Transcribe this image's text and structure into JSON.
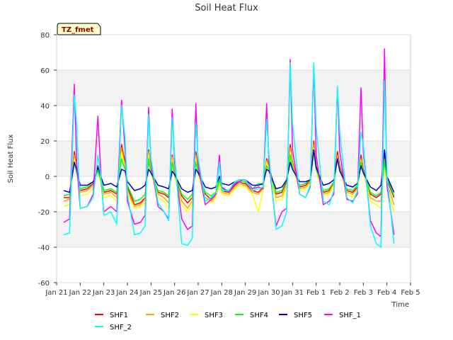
{
  "chart_data": {
    "type": "line",
    "title": "Soil Heat Flux",
    "xlabel": "Time",
    "ylabel": "Soil Heat Flux",
    "badge": "TZ_fmet",
    "ylim": [
      -60,
      80
    ],
    "yticks": [
      -60,
      -40,
      -20,
      0,
      20,
      40,
      60,
      80
    ],
    "xlim": [
      0,
      15
    ],
    "xticks": [
      {
        "x": 0,
        "label": "Jan 21"
      },
      {
        "x": 1,
        "label": "Jan 22"
      },
      {
        "x": 2,
        "label": "Jan 23"
      },
      {
        "x": 3,
        "label": "Jan 24"
      },
      {
        "x": 4,
        "label": "Jan 25"
      },
      {
        "x": 5,
        "label": "Jan 26"
      },
      {
        "x": 6,
        "label": "Jan 27"
      },
      {
        "x": 7,
        "label": "Jan 28"
      },
      {
        "x": 8,
        "label": "Jan 29"
      },
      {
        "x": 9,
        "label": "Jan 30"
      },
      {
        "x": 10,
        "label": "Jan 31"
      },
      {
        "x": 11,
        "label": "Feb 1"
      },
      {
        "x": 12,
        "label": "Feb 2"
      },
      {
        "x": 13,
        "label": "Feb 3"
      },
      {
        "x": 14,
        "label": "Feb 4"
      },
      {
        "x": 15,
        "label": "Feb 5"
      }
    ],
    "grid": true,
    "legend_position": "bottom",
    "x": [
      0.3,
      0.55,
      0.75,
      0.85,
      1.0,
      1.3,
      1.55,
      1.75,
      1.9,
      2.0,
      2.3,
      2.55,
      2.75,
      2.9,
      3.0,
      3.3,
      3.55,
      3.75,
      3.9,
      4.0,
      4.3,
      4.55,
      4.75,
      4.9,
      5.0,
      5.3,
      5.55,
      5.75,
      5.9,
      6.0,
      6.3,
      6.55,
      6.75,
      6.9,
      7.0,
      7.3,
      7.55,
      7.75,
      7.9,
      8.0,
      8.3,
      8.55,
      8.75,
      8.9,
      9.0,
      9.3,
      9.55,
      9.75,
      9.9,
      10.0,
      10.3,
      10.55,
      10.75,
      10.9,
      11.0,
      11.3,
      11.55,
      11.75,
      11.9,
      12.0,
      12.3,
      12.55,
      12.75,
      12.9,
      13.0,
      13.3,
      13.55,
      13.75,
      13.9,
      14.0,
      14.3
    ],
    "series": [
      {
        "name": "SHF1",
        "color": "#ff0000",
        "values": [
          -12,
          -12,
          14,
          5,
          -8,
          -7,
          -4,
          6,
          -3,
          -9,
          -8,
          -10,
          18,
          8,
          -6,
          -16,
          -15,
          -12,
          15,
          4,
          -9,
          -10,
          -12,
          12,
          2,
          -11,
          -15,
          -12,
          14,
          3,
          -10,
          -13,
          -10,
          -2,
          -8,
          -9,
          -5,
          -3,
          -4,
          -4,
          -8,
          -9,
          -6,
          10,
          6,
          -10,
          -9,
          -3,
          18,
          8,
          -6,
          -5,
          -2,
          20,
          6,
          -9,
          -8,
          -3,
          14,
          6,
          -8,
          -9,
          -6,
          12,
          4,
          -10,
          -12,
          -10,
          12,
          -2,
          -12
        ]
      },
      {
        "name": "SHF2",
        "color": "#ffa500",
        "values": [
          -14,
          -13,
          12,
          4,
          -9,
          -8,
          -5,
          5,
          -4,
          -10,
          -9,
          -12,
          16,
          6,
          -8,
          -17,
          -16,
          -13,
          14,
          3,
          -10,
          -12,
          -15,
          11,
          1,
          -14,
          -18,
          -14,
          12,
          2,
          -12,
          -14,
          -11,
          -3,
          -9,
          -10,
          -6,
          -4,
          -5,
          -5,
          -9,
          -10,
          -7,
          9,
          5,
          -12,
          -11,
          -5,
          16,
          7,
          -7,
          -6,
          -3,
          18,
          5,
          -10,
          -9,
          -4,
          12,
          5,
          -9,
          -10,
          -7,
          10,
          3,
          -12,
          -14,
          -14,
          10,
          -4,
          -16
        ]
      },
      {
        "name": "SHF3",
        "color": "#ffff00",
        "values": [
          -17,
          -16,
          10,
          3,
          -11,
          -10,
          -7,
          4,
          -6,
          -12,
          -11,
          -14,
          14,
          5,
          -10,
          -18,
          -17,
          -15,
          12,
          2,
          -12,
          -14,
          -18,
          10,
          0,
          -16,
          -20,
          -16,
          10,
          1,
          -14,
          -15,
          -12,
          -4,
          -10,
          -11,
          -7,
          -5,
          -6,
          -6,
          -10,
          -20,
          -8,
          8,
          4,
          -14,
          -13,
          -6,
          14,
          6,
          -8,
          -7,
          -4,
          16,
          4,
          -11,
          -10,
          -6,
          10,
          4,
          -10,
          -12,
          -9,
          9,
          2,
          -14,
          -16,
          -18,
          8,
          -6,
          -20
        ]
      },
      {
        "name": "SHF4",
        "color": "#00ff00",
        "values": [
          -11,
          -10,
          8,
          2,
          -7,
          -6,
          -3,
          3,
          -3,
          -8,
          -7,
          -9,
          10,
          4,
          -5,
          -14,
          -13,
          -10,
          10,
          2,
          -8,
          -9,
          -11,
          8,
          1,
          -10,
          -13,
          -10,
          8,
          2,
          -9,
          -11,
          -9,
          -2,
          -7,
          -8,
          -4,
          -2,
          -3,
          -3,
          -7,
          -4,
          -5,
          6,
          4,
          -9,
          -8,
          -2,
          12,
          5,
          -5,
          -4,
          -2,
          14,
          4,
          -8,
          -7,
          -3,
          10,
          4,
          -7,
          -8,
          -5,
          8,
          3,
          -9,
          -11,
          -9,
          8,
          -1,
          -11
        ]
      },
      {
        "name": "SHF5",
        "color": "#0000cd",
        "values": [
          -8,
          -9,
          8,
          4,
          -5,
          -5,
          -3,
          5,
          -1,
          -5,
          -4,
          -6,
          4,
          3,
          -3,
          -8,
          -7,
          -5,
          4,
          2,
          -5,
          -6,
          -7,
          3,
          1,
          -7,
          -9,
          -8,
          4,
          2,
          -6,
          -7,
          -6,
          0,
          -4,
          -5,
          -3,
          -2,
          -2,
          -2,
          -5,
          -5,
          -4,
          4,
          3,
          -7,
          -6,
          -2,
          8,
          4,
          -3,
          -3,
          -2,
          15,
          5,
          -5,
          -4,
          -2,
          10,
          3,
          -5,
          -6,
          -4,
          6,
          2,
          -6,
          -8,
          -5,
          15,
          0,
          -9
        ]
      },
      {
        "name": "SHF_1",
        "color": "#ff00ff",
        "values": [
          -26,
          -24,
          52,
          8,
          -18,
          -17,
          -10,
          34,
          -5,
          -20,
          -17,
          -20,
          43,
          15,
          -14,
          -27,
          -26,
          -22,
          39,
          8,
          -17,
          -20,
          -24,
          38,
          8,
          -24,
          -30,
          -28,
          41,
          6,
          -16,
          -13,
          -10,
          12,
          -6,
          -9,
          -4,
          -3,
          -2,
          -2,
          -7,
          -6,
          -7,
          41,
          8,
          -28,
          -20,
          -18,
          66,
          15,
          -10,
          -12,
          -6,
          63,
          12,
          -16,
          -14,
          -10,
          50,
          14,
          -13,
          -14,
          -10,
          50,
          14,
          -25,
          -32,
          -34,
          72,
          -5,
          -33
        ]
      },
      {
        "name": "SHF_2",
        "color": "#00ffff",
        "values": [
          -33,
          -32,
          46,
          30,
          -18,
          -17,
          -12,
          12,
          -3,
          -22,
          -20,
          -27,
          40,
          22,
          -10,
          -33,
          -32,
          -28,
          35,
          10,
          -15,
          -20,
          -25,
          33,
          12,
          -38,
          -39,
          -35,
          30,
          10,
          -14,
          -12,
          -9,
          8,
          -8,
          -8,
          -3,
          -2,
          -2,
          -2,
          -8,
          -7,
          -6,
          32,
          12,
          -30,
          -28,
          -20,
          64,
          30,
          -10,
          -12,
          -5,
          64,
          28,
          -14,
          -16,
          -8,
          51,
          25,
          -12,
          -15,
          -8,
          25,
          18,
          -28,
          -38,
          -40,
          54,
          0,
          -38
        ]
      }
    ]
  }
}
